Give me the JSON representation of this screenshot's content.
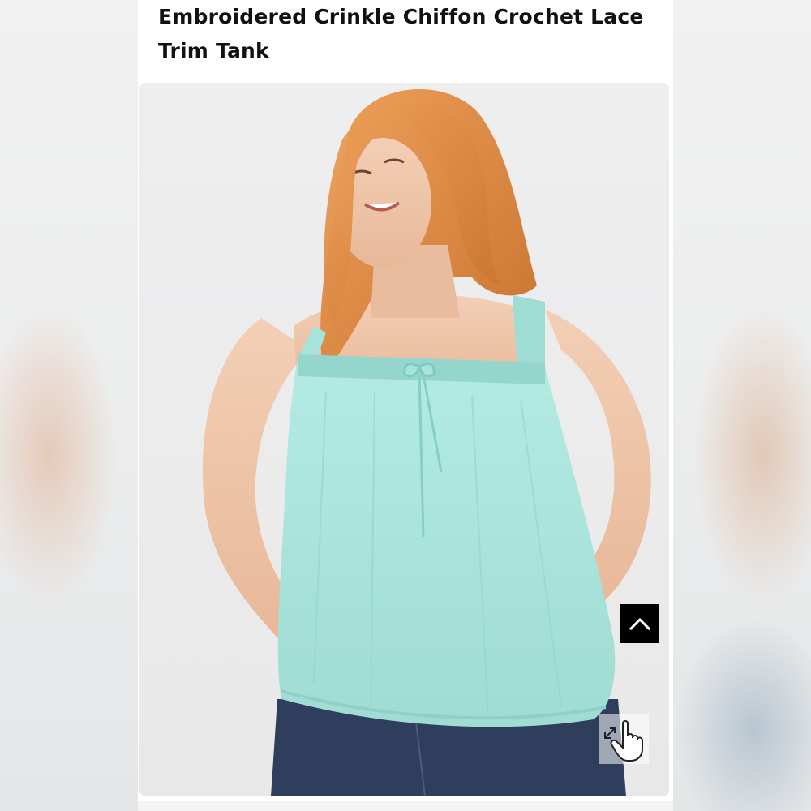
{
  "product": {
    "title": "Embroidered Crinkle Chiffon Crochet Lace Trim Tank"
  },
  "gallery": {
    "image_description_alt": "Model wearing a mint chiffon tank top with crochet lace trim straps and tie neckline, paired with dark denim",
    "colors": {
      "top": "#a9e6de",
      "hair": "#e08a45",
      "skin": "#f0c7ad",
      "denim": "#2f3e5c"
    }
  },
  "controls": {
    "scroll_top_icon": "chevron-up-icon",
    "zoom_icon": "expand-hand-icon"
  }
}
